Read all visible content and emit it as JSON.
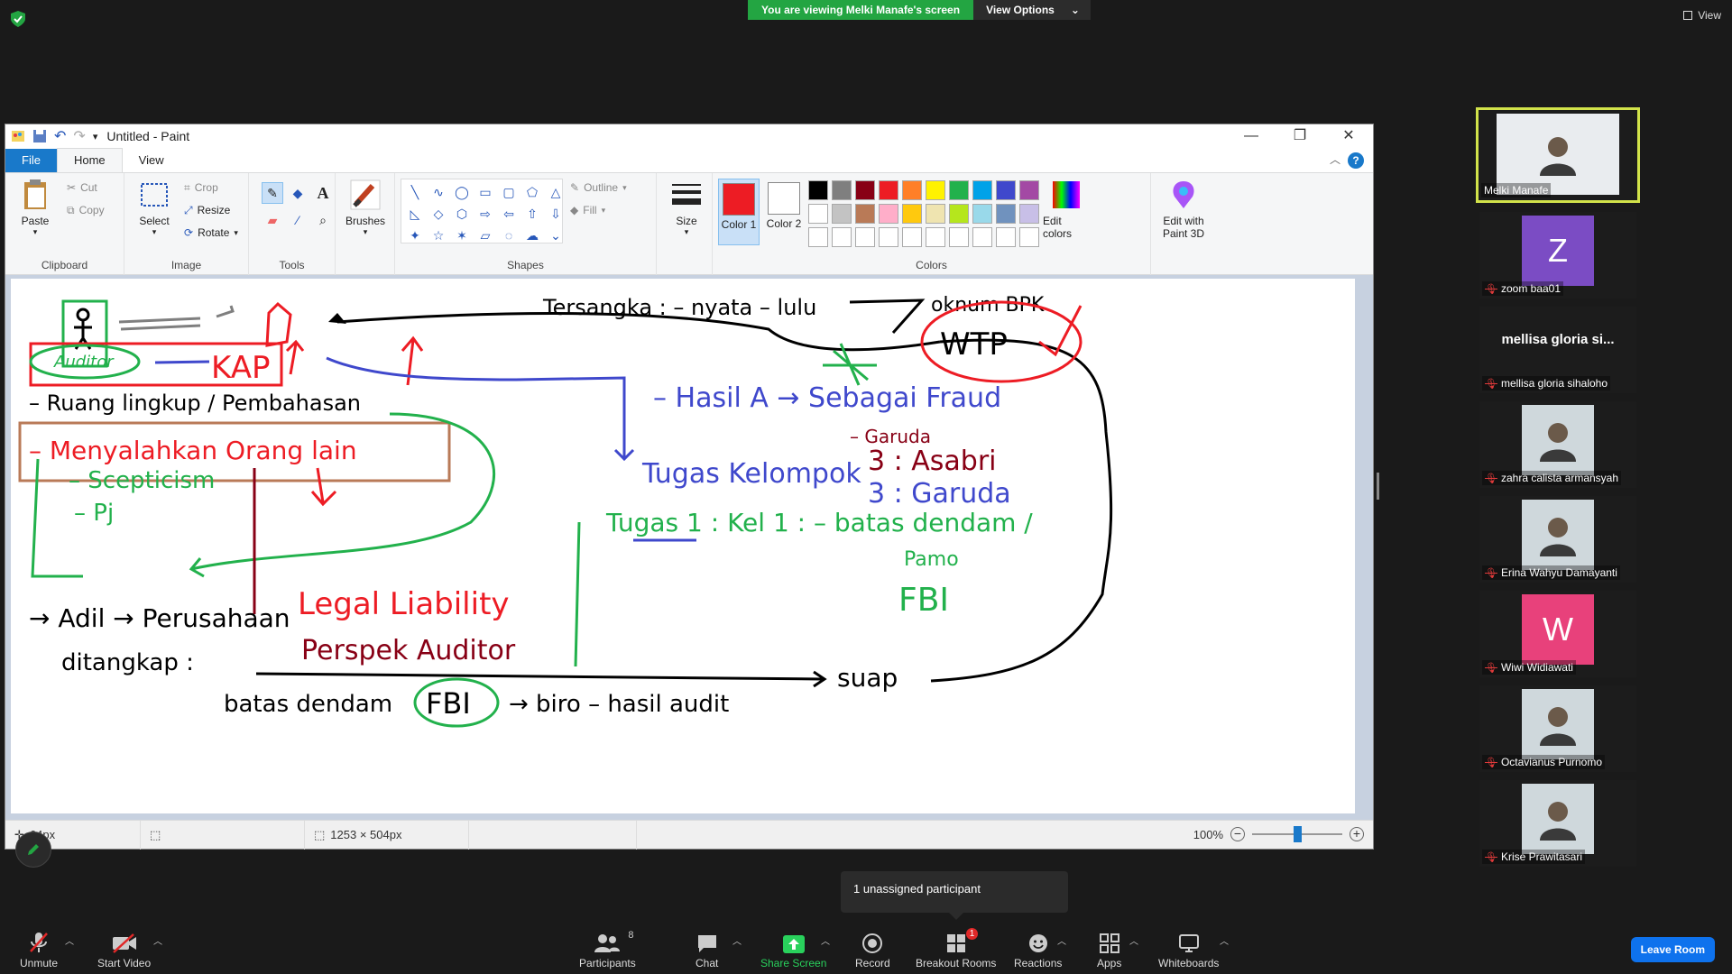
{
  "banner": {
    "viewing_text": "You are viewing Melki Manafe's screen",
    "view_options": "View Options",
    "top_right_view": "View"
  },
  "paint": {
    "window_title": "Untitled - Paint",
    "tabs": [
      "File",
      "Home",
      "View"
    ],
    "clipboard": {
      "paste": "Paste",
      "cut": "Cut",
      "copy": "Copy",
      "label": "Clipboard"
    },
    "image": {
      "select": "Select",
      "crop": "Crop",
      "resize": "Resize",
      "rotate": "Rotate",
      "label": "Image"
    },
    "tools": {
      "label": "Tools"
    },
    "brushes": {
      "label": "Brushes"
    },
    "shapes": {
      "outline": "Outline",
      "fill": "Fill",
      "label": "Shapes"
    },
    "size": {
      "label": "Size"
    },
    "colors": {
      "color1": "Color 1",
      "color2": "Color 2",
      "label": "Colors",
      "edit_colors": "Edit colors",
      "edit_paint3d": "Edit with Paint 3D",
      "color1_value": "#ed1c24",
      "color2_value": "#ffffff",
      "palette_row1": [
        "#000000",
        "#7f7f7f",
        "#880015",
        "#ed1c24",
        "#ff7f27",
        "#fff200",
        "#22b14c",
        "#00a2e8",
        "#3f48cc",
        "#a349a4"
      ],
      "palette_row2": [
        "#ffffff",
        "#c3c3c3",
        "#b97a57",
        "#ffaec9",
        "#ffc90e",
        "#efe4b0",
        "#b5e61d",
        "#99d9ea",
        "#7092be",
        "#c8bfe7"
      ],
      "palette_row3": [
        "#ffffff",
        "#ffffff",
        "#ffffff",
        "#ffffff",
        "#ffffff",
        "#ffffff",
        "#ffffff",
        "#ffffff",
        "#ffffff",
        "#ffffff"
      ]
    },
    "status": {
      "brush_size": "64px",
      "dimensions": "1253 × 504px",
      "zoom": "100%"
    },
    "zoom_slider": 0.5,
    "canvas_text": {
      "t_kap": "KAP",
      "t_auditor": "Auditor",
      "t_ruang": "– Ruang lingkup / Pembahasan",
      "t_menyalahkan": "– Menyalahkan Orang lain",
      "t_scepti": "– Scepticism",
      "t_pj": "– Pj",
      "t_hasil": "– Hasil A → Sebagai Fraud",
      "t_garuda1": "– Garuda",
      "t_tugas_kel": "Tugas Kelompok",
      "t_asabri": "3 : Asabri",
      "t_garuda2": "3 : Garuda",
      "t_tugas1": "Tugas 1 : Kel 1 : – batas dendam /",
      "t_pamo": "Pamo",
      "t_fbi_right": "FBI",
      "t_adil": "→ Adil → Perusahaan",
      "t_legal": "Legal Liability",
      "t_perspek": "Perspek Auditor",
      "t_ditangkap": "ditangkap :",
      "t_batas": "batas dendam",
      "t_fbi": "FBI",
      "t_biro": "→ biro – hasil audit",
      "t_suap": "suap",
      "t_wtp": "WTP",
      "t_oknum": "oknum BPK",
      "t_tersangka": "Tersangka : – nyata – lulu"
    }
  },
  "participants": [
    {
      "name": "Melki Manafe",
      "type": "video",
      "active": true,
      "muted": false
    },
    {
      "name": "zoom baa01",
      "type": "letter",
      "letter": "Z",
      "bg": "#7b4cc4",
      "muted": true
    },
    {
      "name": "mellisa gloria sihaloho",
      "type": "name",
      "bigname": "mellisa gloria si...",
      "muted": true
    },
    {
      "name": "zahra calista armansyah",
      "type": "photo",
      "muted": true
    },
    {
      "name": "Erina Wahyu Damayanti",
      "type": "photo",
      "muted": true
    },
    {
      "name": "Wiwi Widiawati",
      "type": "letter",
      "letter": "W",
      "bg": "#e8417b",
      "muted": true
    },
    {
      "name": "Octavianus Purnomo",
      "type": "photo",
      "muted": true
    },
    {
      "name": "Krise Prawitasari",
      "type": "photo",
      "muted": true
    }
  ],
  "toolbar": {
    "unmute": "Unmute",
    "start_video": "Start Video",
    "participants": "Participants",
    "participants_count": "8",
    "chat": "Chat",
    "share_screen": "Share Screen",
    "record": "Record",
    "breakout": "Breakout Rooms",
    "breakout_badge": "1",
    "reactions": "Reactions",
    "apps": "Apps",
    "whiteboards": "Whiteboards",
    "leave": "Leave Room",
    "tooltip": "1 unassigned participant"
  }
}
